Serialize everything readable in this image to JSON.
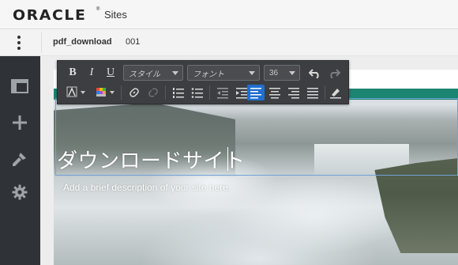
{
  "header": {
    "logo_text": "ORACLE",
    "reg_mark": "®",
    "app_name": "Sites"
  },
  "subheader": {
    "site_name": "pdf_download",
    "site_update": "001"
  },
  "sidebar": {
    "items": [
      {
        "name": "layout-icon"
      },
      {
        "name": "add-icon"
      },
      {
        "name": "brush-icon"
      },
      {
        "name": "settings-gear-icon"
      }
    ]
  },
  "toolbar": {
    "bold_label": "B",
    "italic_label": "I",
    "underline_label": "U",
    "style_placeholder": "スタイル",
    "font_placeholder": "フォント",
    "font_size": "36",
    "active_alignment": "align-left",
    "accent_color": "#1e6fd0"
  },
  "hero": {
    "title": "ダウンロードサイト",
    "description": "Add a brief description of your site here.",
    "section_color": "#1b8571"
  }
}
